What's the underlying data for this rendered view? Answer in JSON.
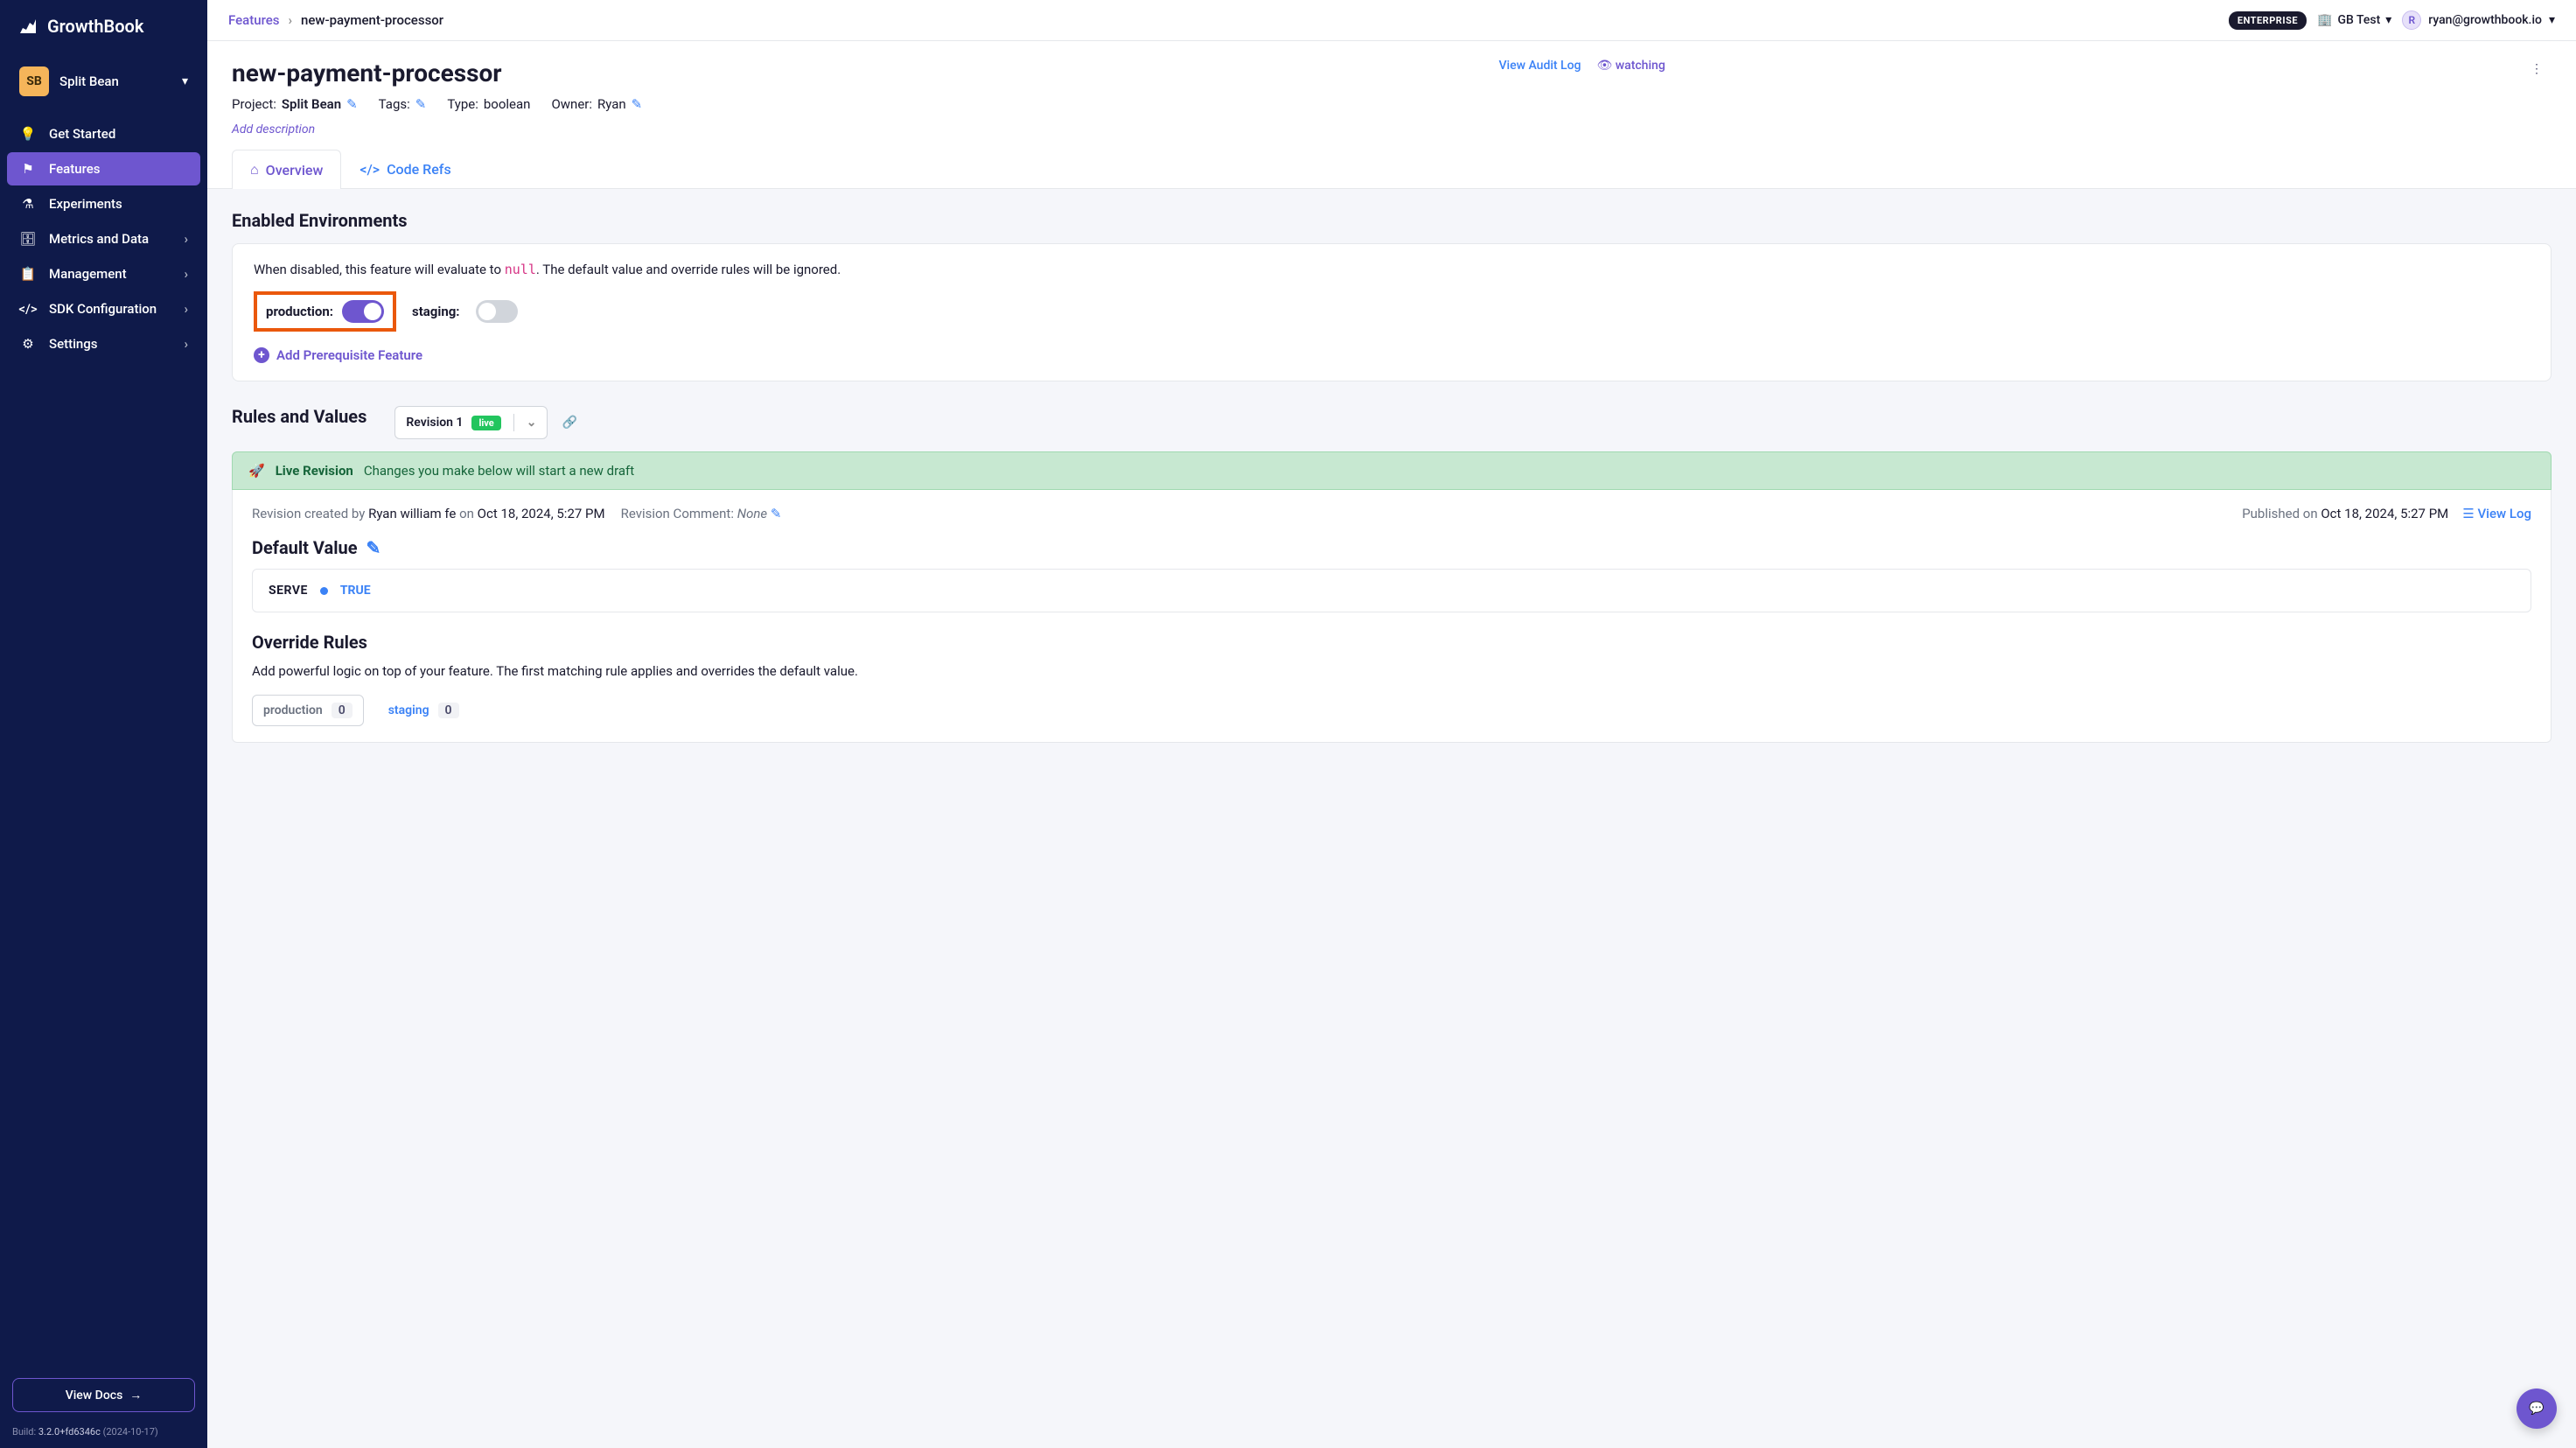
{
  "app_name": "GrowthBook",
  "sidebar": {
    "project_badge": "SB",
    "project_name": "Split Bean",
    "items": [
      {
        "label": "Get Started"
      },
      {
        "label": "Features"
      },
      {
        "label": "Experiments"
      },
      {
        "label": "Metrics and Data"
      },
      {
        "label": "Management"
      },
      {
        "label": "SDK Configuration"
      },
      {
        "label": "Settings"
      }
    ],
    "view_docs": "View Docs",
    "build_prefix": "Build: ",
    "build_version": "3.2.0+fd6346c",
    "build_date": " (2024-10-17)"
  },
  "topbar": {
    "breadcrumb_root": "Features",
    "breadcrumb_current": "new-payment-processor",
    "enterprise": "ENTERPRISE",
    "org": "GB Test",
    "user_initial": "R",
    "user_email": "ryan@growthbook.io"
  },
  "header": {
    "title": "new-payment-processor",
    "project_label": "Project: ",
    "project_value": "Split Bean",
    "tags_label": "Tags:",
    "type_label": "Type: ",
    "type_value": "boolean",
    "owner_label": "Owner: ",
    "owner_value": "Ryan",
    "view_audit": "View Audit Log",
    "watching": "watching",
    "add_description": "Add description",
    "tab_overview": "Overview",
    "tab_code_refs": "Code Refs"
  },
  "env_section": {
    "title": "Enabled Environments",
    "desc_before": "When disabled, this feature will evaluate to ",
    "null_text": "null",
    "desc_after": ". The default value and override rules will be ignored.",
    "prod_label": "production:",
    "staging_label": "staging:",
    "add_prereq": "Add Prerequisite Feature"
  },
  "rules_section": {
    "title": "Rules and Values",
    "revision_label": "Revision 1",
    "live_badge": "live",
    "banner_title": "Live Revision",
    "banner_desc": "Changes you make below will start a new draft",
    "rev_created_prefix": "Revision created by ",
    "rev_created_by": "Ryan william fe",
    "rev_created_on": " on ",
    "rev_created_date": "Oct 18, 2024, 5:27 PM",
    "rev_comment_prefix": "Revision Comment: ",
    "rev_comment_value": "None",
    "published_prefix": "Published on ",
    "published_date": "Oct 18, 2024, 5:27 PM",
    "view_log": "View Log",
    "default_value_title": "Default Value",
    "serve": "SERVE",
    "true": "TRUE",
    "override_title": "Override Rules",
    "override_desc": "Add powerful logic on top of your feature. The first matching rule applies and overrides the default value.",
    "prod_tab": "production",
    "prod_count": "0",
    "staging_tab": "staging",
    "staging_count": "0"
  }
}
